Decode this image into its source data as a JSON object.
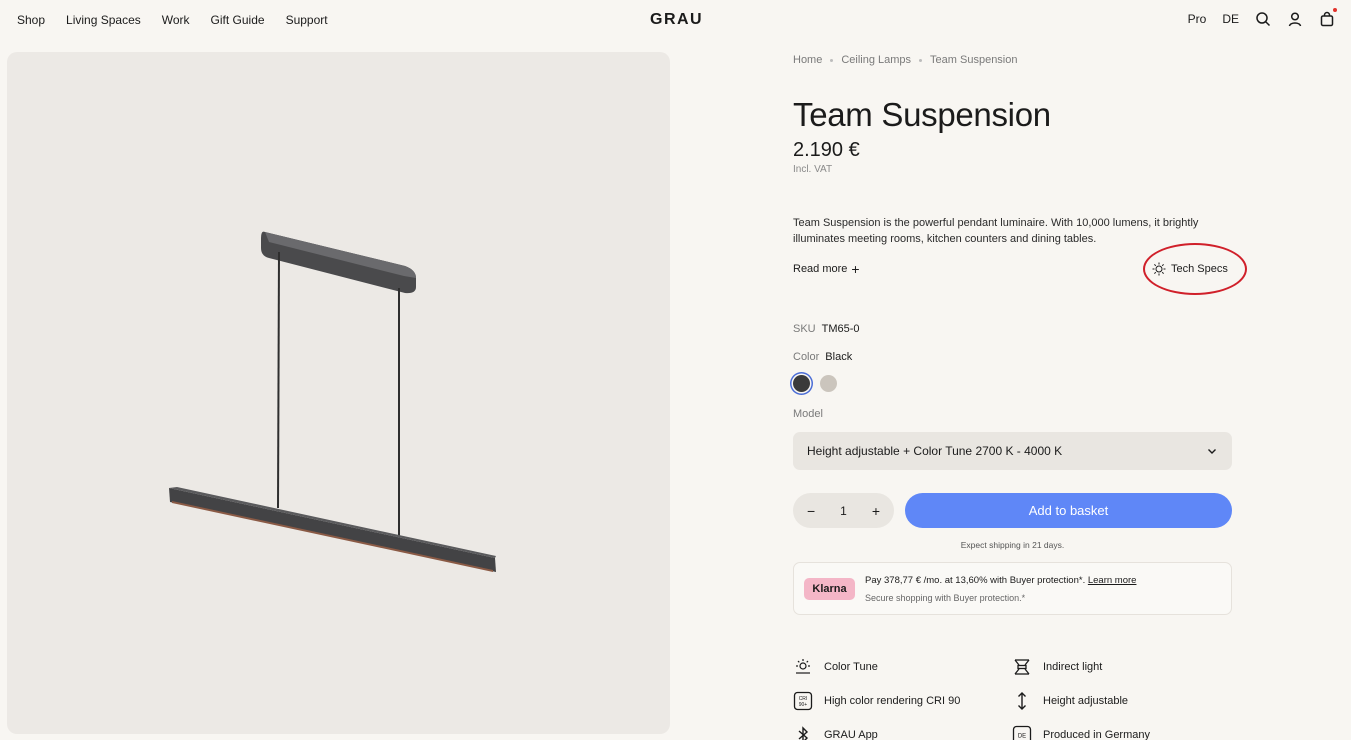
{
  "header": {
    "nav": [
      "Shop",
      "Living Spaces",
      "Work",
      "Gift Guide",
      "Support"
    ],
    "logo": "GRAU",
    "pro": "Pro",
    "lang": "DE"
  },
  "breadcrumb": [
    "Home",
    "Ceiling Lamps",
    "Team Suspension"
  ],
  "product": {
    "title": "Team Suspension",
    "price": "2.190 €",
    "vat": "Incl. VAT",
    "description": "Team Suspension is the powerful pendant luminaire. With 10,000 lumens, it brightly illuminates meeting rooms, kitchen counters and dining tables.",
    "read_more": "Read more",
    "tech_specs": "Tech Specs",
    "sku_label": "SKU",
    "sku": "TM65-0",
    "color_label": "Color",
    "color": "Black",
    "swatch_colors": [
      "#3a3a3a",
      "#cbc5bd"
    ],
    "model_label": "Model",
    "model": "Height adjustable + Color Tune 2700 K - 4000 K",
    "quantity": "1",
    "add_to_basket": "Add to basket",
    "shipping": "Expect shipping in 21 days.",
    "accent_color": "#5f87f7"
  },
  "klarna": {
    "badge": "Klarna",
    "line1": "Pay 378,77 € /mo. at 13,60% with Buyer protection*.",
    "learn_more": "Learn more",
    "line2": "Secure shopping with Buyer protection.*"
  },
  "features": [
    {
      "icon": "color-tune-icon",
      "label": "Color Tune"
    },
    {
      "icon": "indirect-light-icon",
      "label": "Indirect light"
    },
    {
      "icon": "cri-icon",
      "label": "High color rendering CRI 90"
    },
    {
      "icon": "height-adjust-icon",
      "label": "Height adjustable"
    },
    {
      "icon": "bluetooth-icon",
      "label": "GRAU App"
    },
    {
      "icon": "de-icon",
      "label": "Produced in Germany"
    }
  ]
}
